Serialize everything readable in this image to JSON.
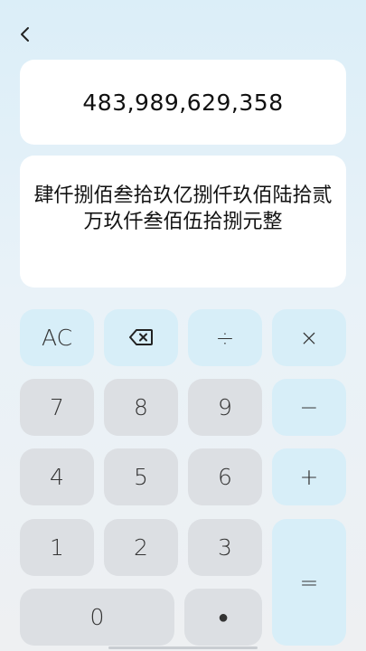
{
  "header": {
    "back_icon": "chevron-left-icon"
  },
  "display": {
    "number": "483,989,629,358",
    "words": "肆仟捌佰叁拾玖亿捌仟玖佰陆拾贰万玖仟叁佰伍拾捌元整"
  },
  "keypad": {
    "clear": "AC",
    "backspace_icon": "backspace-icon",
    "divide": "÷",
    "multiply": "×",
    "minus": "−",
    "plus": "+",
    "equals": "=",
    "dot": "●",
    "digits": {
      "d0": "0",
      "d1": "1",
      "d2": "2",
      "d3": "3",
      "d4": "4",
      "d5": "5",
      "d6": "6",
      "d7": "7",
      "d8": "8",
      "d9": "9"
    }
  },
  "colors": {
    "operator_key": "#d7eef8",
    "digit_key": "#dcdfe3",
    "card": "#ffffff"
  }
}
